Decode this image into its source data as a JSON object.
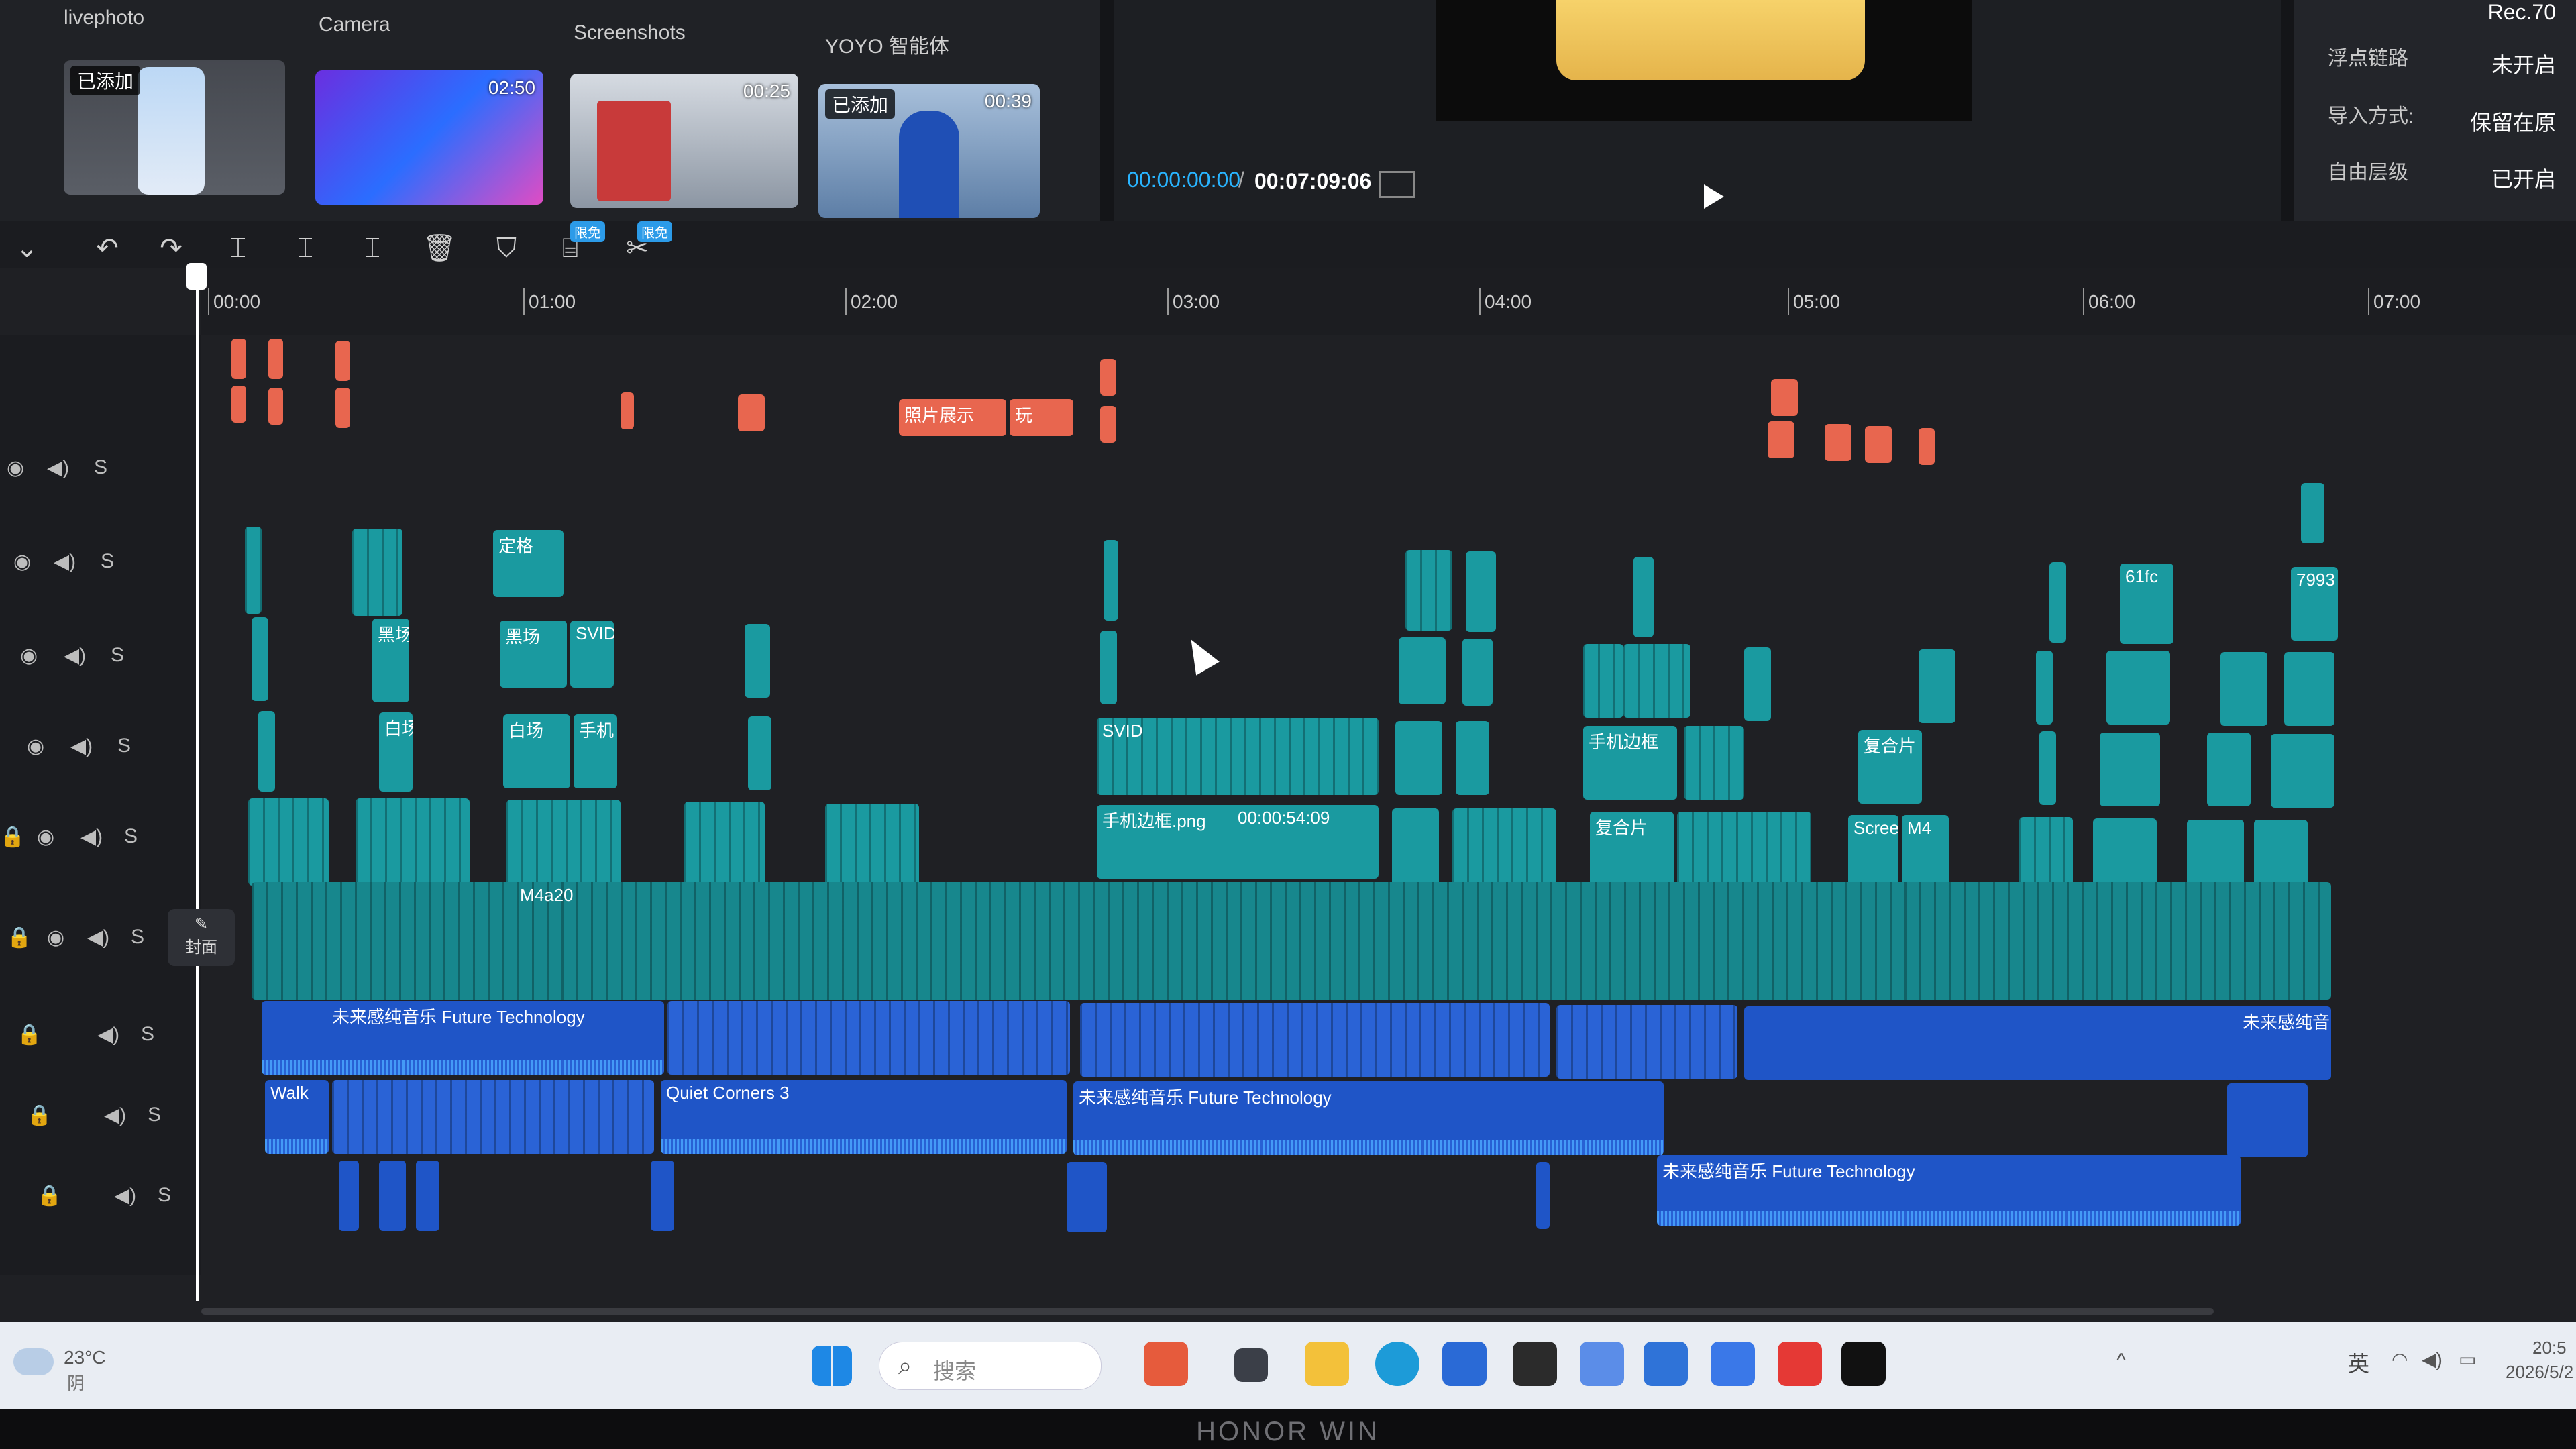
{
  "media": {
    "categories": [
      "livephoto",
      "Camera",
      "Screenshots",
      "YOYO 智能体"
    ],
    "thumbs": [
      {
        "badge": "已添加",
        "duration": ""
      },
      {
        "badge": "",
        "duration": "02:50"
      },
      {
        "badge": "",
        "duration": "00:25"
      },
      {
        "badge": "已添加",
        "duration": "00:39"
      }
    ]
  },
  "player": {
    "current_time": "00:00:00:00",
    "separator": "/",
    "total_time": "00:07:09:06"
  },
  "properties": {
    "rows": [
      {
        "label": "浮点链路",
        "value": "未开启"
      },
      {
        "label": "导入方式:",
        "value": "保留在原"
      },
      {
        "label": "自由层级",
        "value": "已开启"
      }
    ],
    "top_value": "Rec.70"
  },
  "toolbar": {
    "tag1": "限免",
    "tag2": "限免"
  },
  "ruler": {
    "ticks": [
      "00:00",
      "01:00",
      "02:00",
      "03:00",
      "04:00",
      "05:00",
      "06:00",
      "07:00"
    ]
  },
  "track_icons": {
    "speaker": "speaker-icon",
    "eye": "eye-icon",
    "lock": "lock-icon"
  },
  "cover_label": "封面",
  "clips": {
    "red_1": "照片展示",
    "red_2": "玩",
    "v1_a": "定格",
    "v2_a": "黑场",
    "v2_b": "黑场",
    "v2_c": "SVID",
    "v3_a": "白场",
    "v3_b": "白场",
    "v3_c": "手机",
    "v3_d": "SVID",
    "v3_e": "手机边框",
    "v3_f": "复合片",
    "v4_a": "手机边框.png",
    "v4_a_time": "00:00:54:09",
    "v4_b": "复合片",
    "v4_c": "Scree",
    "v4_d": "M4",
    "v2_d": "61fc",
    "v2_e": "7993",
    "main_a": "M4a20",
    "a1_a": "未来感纯音乐  Future Technology",
    "a1_b": "未来感纯音",
    "a2_a": "Walk",
    "a2_b": "Quiet Corners 3",
    "a2_c": "未来感纯音乐  Future Technology",
    "a3_a": "未来感纯音乐  Future Technology"
  },
  "taskbar": {
    "weather_temp": "23°C",
    "weather_desc": "阴",
    "search_placeholder": "搜索",
    "lang": "英",
    "clock": "20:5",
    "date": "2026/5/2"
  },
  "monitor_brand": "HONOR WIN"
}
